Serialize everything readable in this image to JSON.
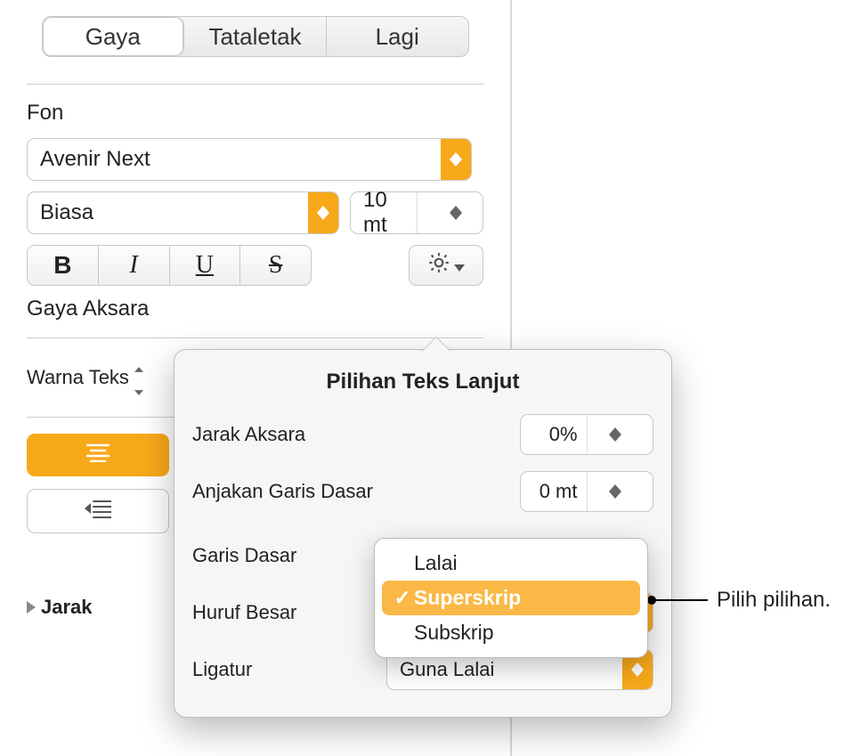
{
  "tabs": {
    "style": "Gaya",
    "layout": "Tataletak",
    "more": "Lagi"
  },
  "font": {
    "section_label": "Fon",
    "family": "Avenir Next",
    "weight": "Biasa",
    "size": "10 mt",
    "bold": "B",
    "italic": "I",
    "underline": "U",
    "strike": "S"
  },
  "character_style_label": "Gaya Aksara",
  "text_color_label": "Warna Teks",
  "spacing_label": "Jarak",
  "popover": {
    "title": "Pilihan Teks Lanjut",
    "char_spacing_label": "Jarak Aksara",
    "char_spacing_value": "0%",
    "baseline_shift_label": "Anjakan Garis Dasar",
    "baseline_shift_value": "0 mt",
    "baseline_label": "Garis Dasar",
    "caps_label": "Huruf Besar",
    "ligature_label": "Ligatur",
    "ligature_value": "Guna Lalai"
  },
  "dropdown": {
    "default": "Lalai",
    "superscript": "Superskrip",
    "subscript": "Subskrip"
  },
  "callout": "Pilih pilihan."
}
